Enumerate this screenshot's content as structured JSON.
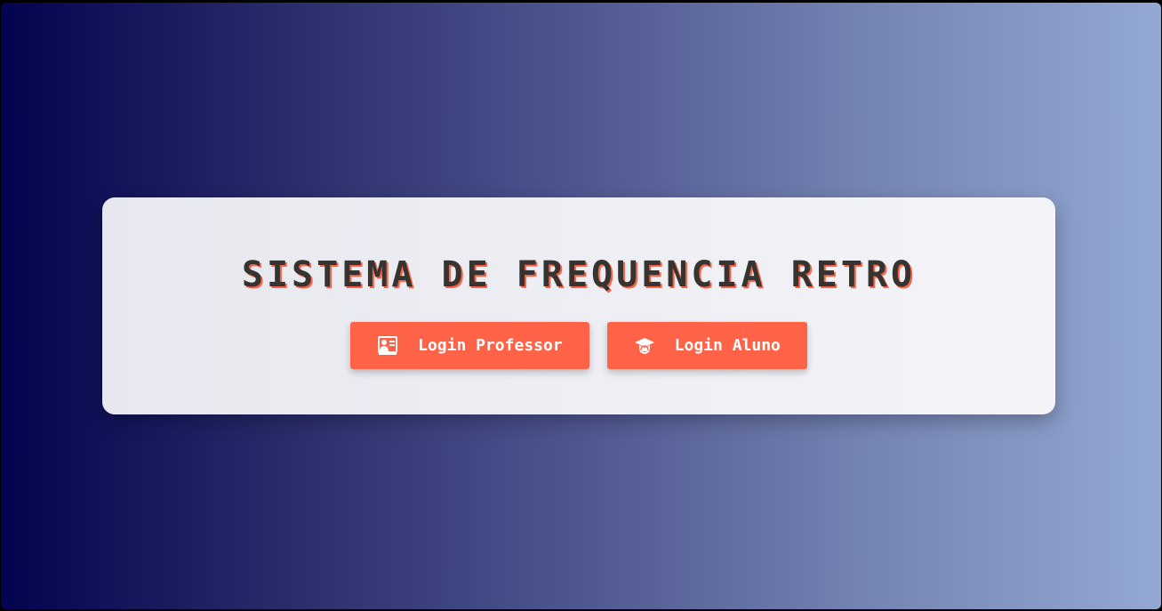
{
  "card": {
    "title": "SISTEMA DE FREQUENCIA RETRO"
  },
  "buttons": {
    "professor": {
      "label": "Login Professor",
      "icon": "chalkboard-teacher-icon"
    },
    "aluno": {
      "label": "Login Aluno",
      "icon": "graduation-cap-icon"
    }
  },
  "colors": {
    "accent": "#ff6347",
    "title": "#353431",
    "card": "#f0f0f5",
    "gradient_start": "#03034f",
    "gradient_end": "#93a8d3"
  }
}
